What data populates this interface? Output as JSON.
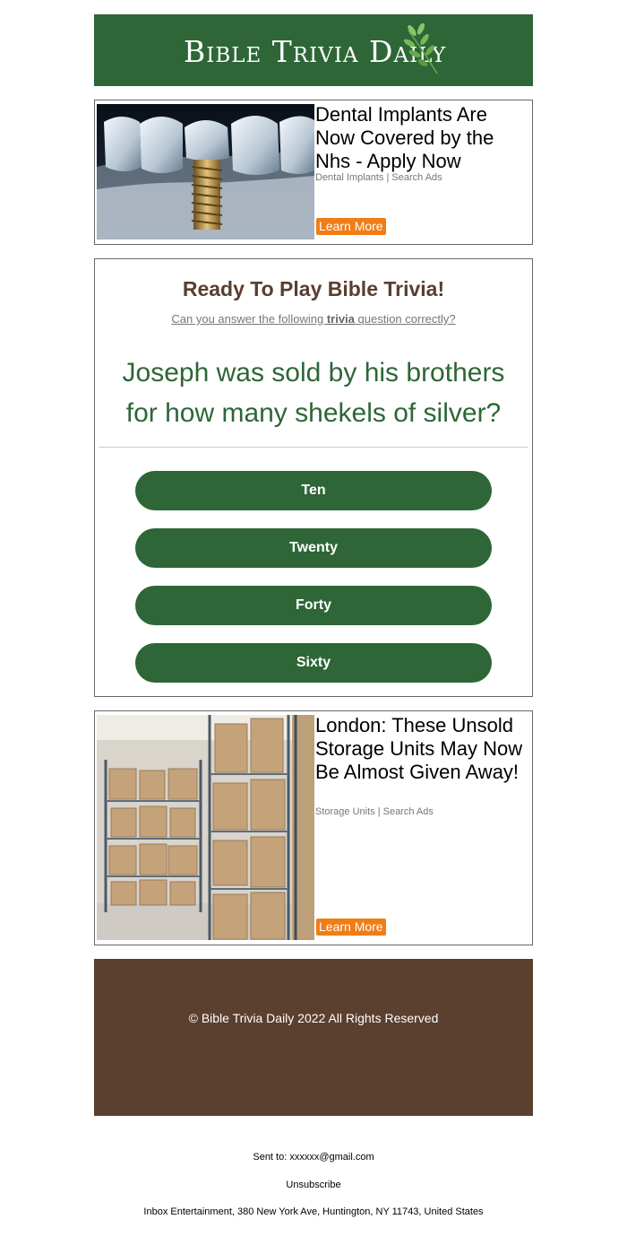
{
  "header": {
    "logo_text": "Bible Trivia Daily"
  },
  "ads": [
    {
      "title": "Dental Implants Are Now Covered by the Nhs - Apply Now",
      "subtitle": "Dental Implants | Search Ads",
      "button_label": "Learn More"
    },
    {
      "title": "London: These Unsold Storage Units May Now Be Almost Given Away!",
      "subtitle": "Storage Units | Search Ads",
      "button_label": "Learn More"
    }
  ],
  "trivia": {
    "heading": "Ready To Play Bible Trivia!",
    "subheading_before": "Can you answer the following ",
    "subheading_bold": "trivia",
    "subheading_after": " question correctly?",
    "question": "Joseph was sold by his brothers for how many shekels of silver?",
    "answers": [
      "Ten",
      "Twenty",
      "Forty",
      "Sixty"
    ]
  },
  "footer": {
    "copyright": "© Bible Trivia Daily 2022 All Rights Reserved"
  },
  "meta": {
    "sent_to": "Sent to: xxxxxx@gmail.com",
    "unsubscribe": "Unsubscribe",
    "address": "Inbox Entertainment, 380 New York Ave, Huntington, NY 11743, United States"
  },
  "colors": {
    "brand_green": "#2e6637",
    "brand_brown": "#5b3f2f",
    "cta_orange": "#f07d16"
  },
  "icons": {
    "logo": "leaf-sprig-icon"
  }
}
